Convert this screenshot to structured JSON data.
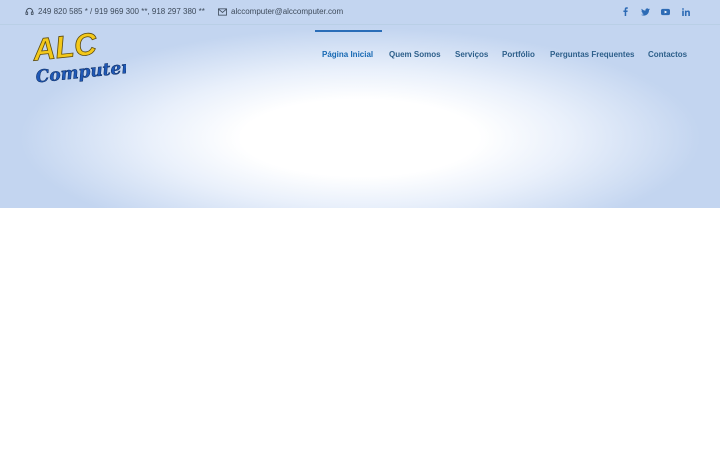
{
  "topbar": {
    "phone_text": "249 820 585 * / 919 969 300 **, 918 297 380 **",
    "email_text": "alccomputer@alccomputer.com",
    "phone_icon": "headset-icon",
    "email_icon": "envelope-icon",
    "social": [
      {
        "name": "facebook-icon",
        "label": "f"
      },
      {
        "name": "twitter-icon",
        "label": "t"
      },
      {
        "name": "youtube-icon",
        "label": "yt"
      },
      {
        "name": "linkedin-icon",
        "label": "in"
      }
    ]
  },
  "logo": {
    "line1": "ALC",
    "line2": "Computer"
  },
  "nav": {
    "items": [
      {
        "label": "Página Inicial",
        "active": true
      },
      {
        "label": "Quem Somos",
        "active": false
      },
      {
        "label": "Serviços",
        "active": false
      },
      {
        "label": "Portfólio",
        "active": false
      },
      {
        "label": "Perguntas Frequentes",
        "active": false
      },
      {
        "label": "Contactos",
        "active": false
      }
    ]
  },
  "colors": {
    "accent": "#2a6db8",
    "nav_text": "#2d5f8a",
    "logo_yellow": "#f3c81a",
    "logo_blue": "#1f58b6"
  }
}
